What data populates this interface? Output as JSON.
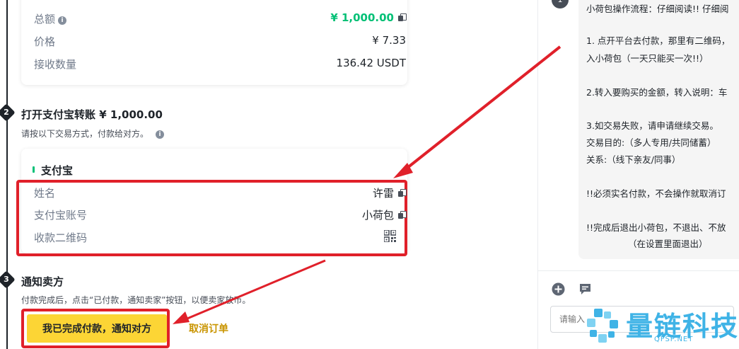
{
  "summary": {
    "total_label": "总额",
    "total_value": "¥ 1,000.00",
    "price_label": "价格",
    "price_value": "¥ 7.33",
    "receive_label": "接收数量",
    "receive_value": "136.42 USDT"
  },
  "step2": {
    "number": "2",
    "title": "打开支付宝转账 ¥ 1,000.00",
    "subtitle": "请按以下交易方式，付款给对方。"
  },
  "payment": {
    "method": "支付宝",
    "name_label": "姓名",
    "name_value": "许雷",
    "account_label": "支付宝账号",
    "account_value": "小荷包",
    "qr_label": "收款二维码"
  },
  "step3": {
    "number": "3",
    "title": "通知卖方",
    "subtitle": "付款完成后，点击“已付款，通知卖家”按钮，以便卖家放币。"
  },
  "actions": {
    "confirm_label": "我已完成付款，通知对方",
    "cancel_label": "取消订单"
  },
  "chat": {
    "avatar": "1",
    "lines": [
      "小荷包操作流程：仔细阅读!! 仔细阅",
      "1. 点开平台去付款，那里有二维码，",
      "入小荷包（一天只能买一次!!）",
      "2.转入要购买的金额，转入说明：车",
      "3.如交易失败，请申请继续交易。",
      "交易目的:（多人专用/共同储蓄）",
      "关系:（线下亲友/同事）",
      "!!必须实名付款，不会操作就取消订",
      "!!完成后退出小荷包，不退出、不放",
      "（在设置里面退出）"
    ],
    "input_placeholder": "请输入"
  },
  "watermark": {
    "text": "量链科技",
    "sub": "QFSP.NET"
  },
  "colors": {
    "accent_green": "#0ecb81",
    "button_yellow": "#fcd535",
    "cancel_gold": "#c99400",
    "annotation_red": "#e0202a",
    "watermark_blue": "#3fb3e6"
  }
}
